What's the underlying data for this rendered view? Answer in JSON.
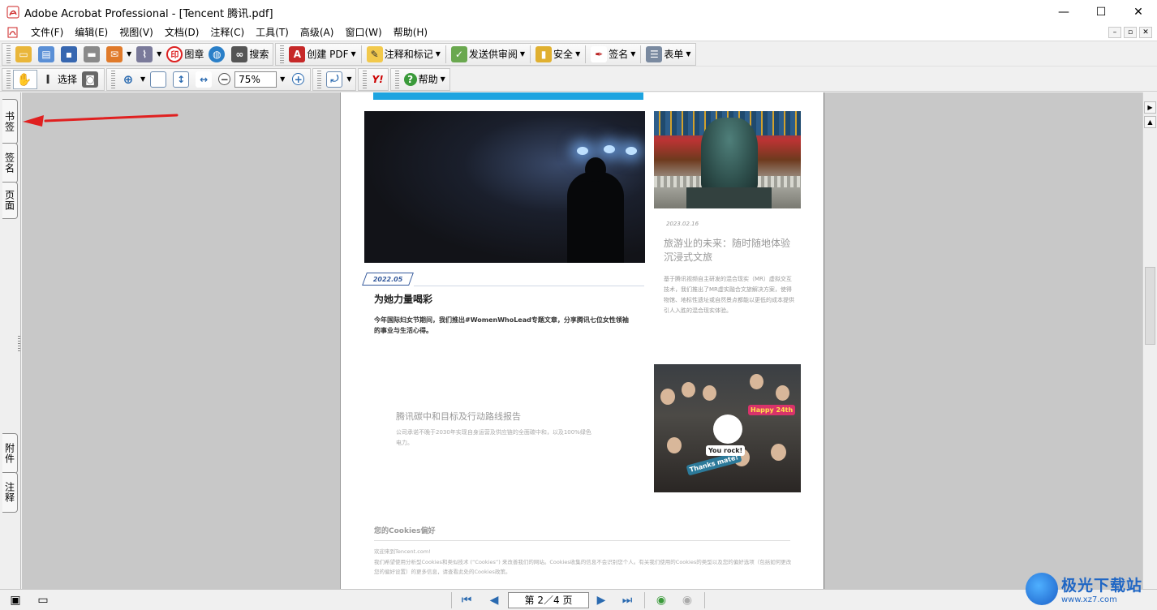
{
  "window": {
    "title": "Adobe Acrobat Professional - [Tencent 腾讯.pdf]",
    "controls": {
      "minimize": "—",
      "maximize": "☐",
      "close": "✕"
    }
  },
  "menu": [
    "文件(F)",
    "编辑(E)",
    "视图(V)",
    "文档(D)",
    "注释(C)",
    "工具(T)",
    "高级(A)",
    "窗口(W)",
    "帮助(H)"
  ],
  "mdi_controls": [
    "–",
    "▫",
    "✕"
  ],
  "toolbar1": {
    "stamp": "图章",
    "search": "搜索",
    "create_pdf": "创建 PDF",
    "comment_markup": "注释和标记",
    "send_review": "发送供审阅",
    "security": "安全",
    "sign": "签名",
    "forms": "表单"
  },
  "toolbar2": {
    "select": "选择",
    "zoom_value": "75%",
    "help": "帮助",
    "yahoo": "Y!"
  },
  "left_tabs": {
    "bookmarks": "书签",
    "signatures": "签名",
    "pages": "页面",
    "attachments": "附件",
    "comments": "注释"
  },
  "document": {
    "left_date": "2022.05",
    "left_heading": "为她力量喝彩",
    "left_body": "今年国际妇女节期间，我们推出#WomenWhoLead专题文章，分享腾讯七位女性领袖的事业与生活心得。",
    "right_date": "2023.02.16",
    "right_heading": "旅游业的未来：随时随地体验沉浸式文旅",
    "right_body": "基于腾讯视频自主研发的混合现实（MR）虚拟交互技术，我们推出了MR虚实融合文旅解决方案，使得物馆、地标性遗址或自然景点都能以更低的成本提供引人入胜的混合现实体验。",
    "mid_heading": "腾讯碳中和目标及行动路线报告",
    "mid_body": "公司承诺不晚于2030年实现自身运营及供应链的全面碳中和，以及100%绿色电力。",
    "crowd_signs": [
      "Happy 24th",
      "Thanks mate!",
      "You rock!"
    ],
    "cookie_heading": "您的Cookies偏好",
    "cookie_body": "欢迎来到Tencent.com!\n我们希望使用分析型Cookies和类似技术 (“Cookies”) 来改善我们的网站。Cookies收集的信息不会识别您个人。有关我们使用的Cookies的类型以及您的偏好选项（包括如何更改您的偏好设置）的更多信息，请查看此处的Cookies政策。"
  },
  "status": {
    "page_indicator": "第 2／4 页"
  },
  "watermark": {
    "main": "极光下载站",
    "sub": "www.xz7.com"
  },
  "colors": {
    "accent_blue": "#1ea4e0",
    "arrow_red": "#e02020",
    "date_blue": "#355a9c"
  }
}
